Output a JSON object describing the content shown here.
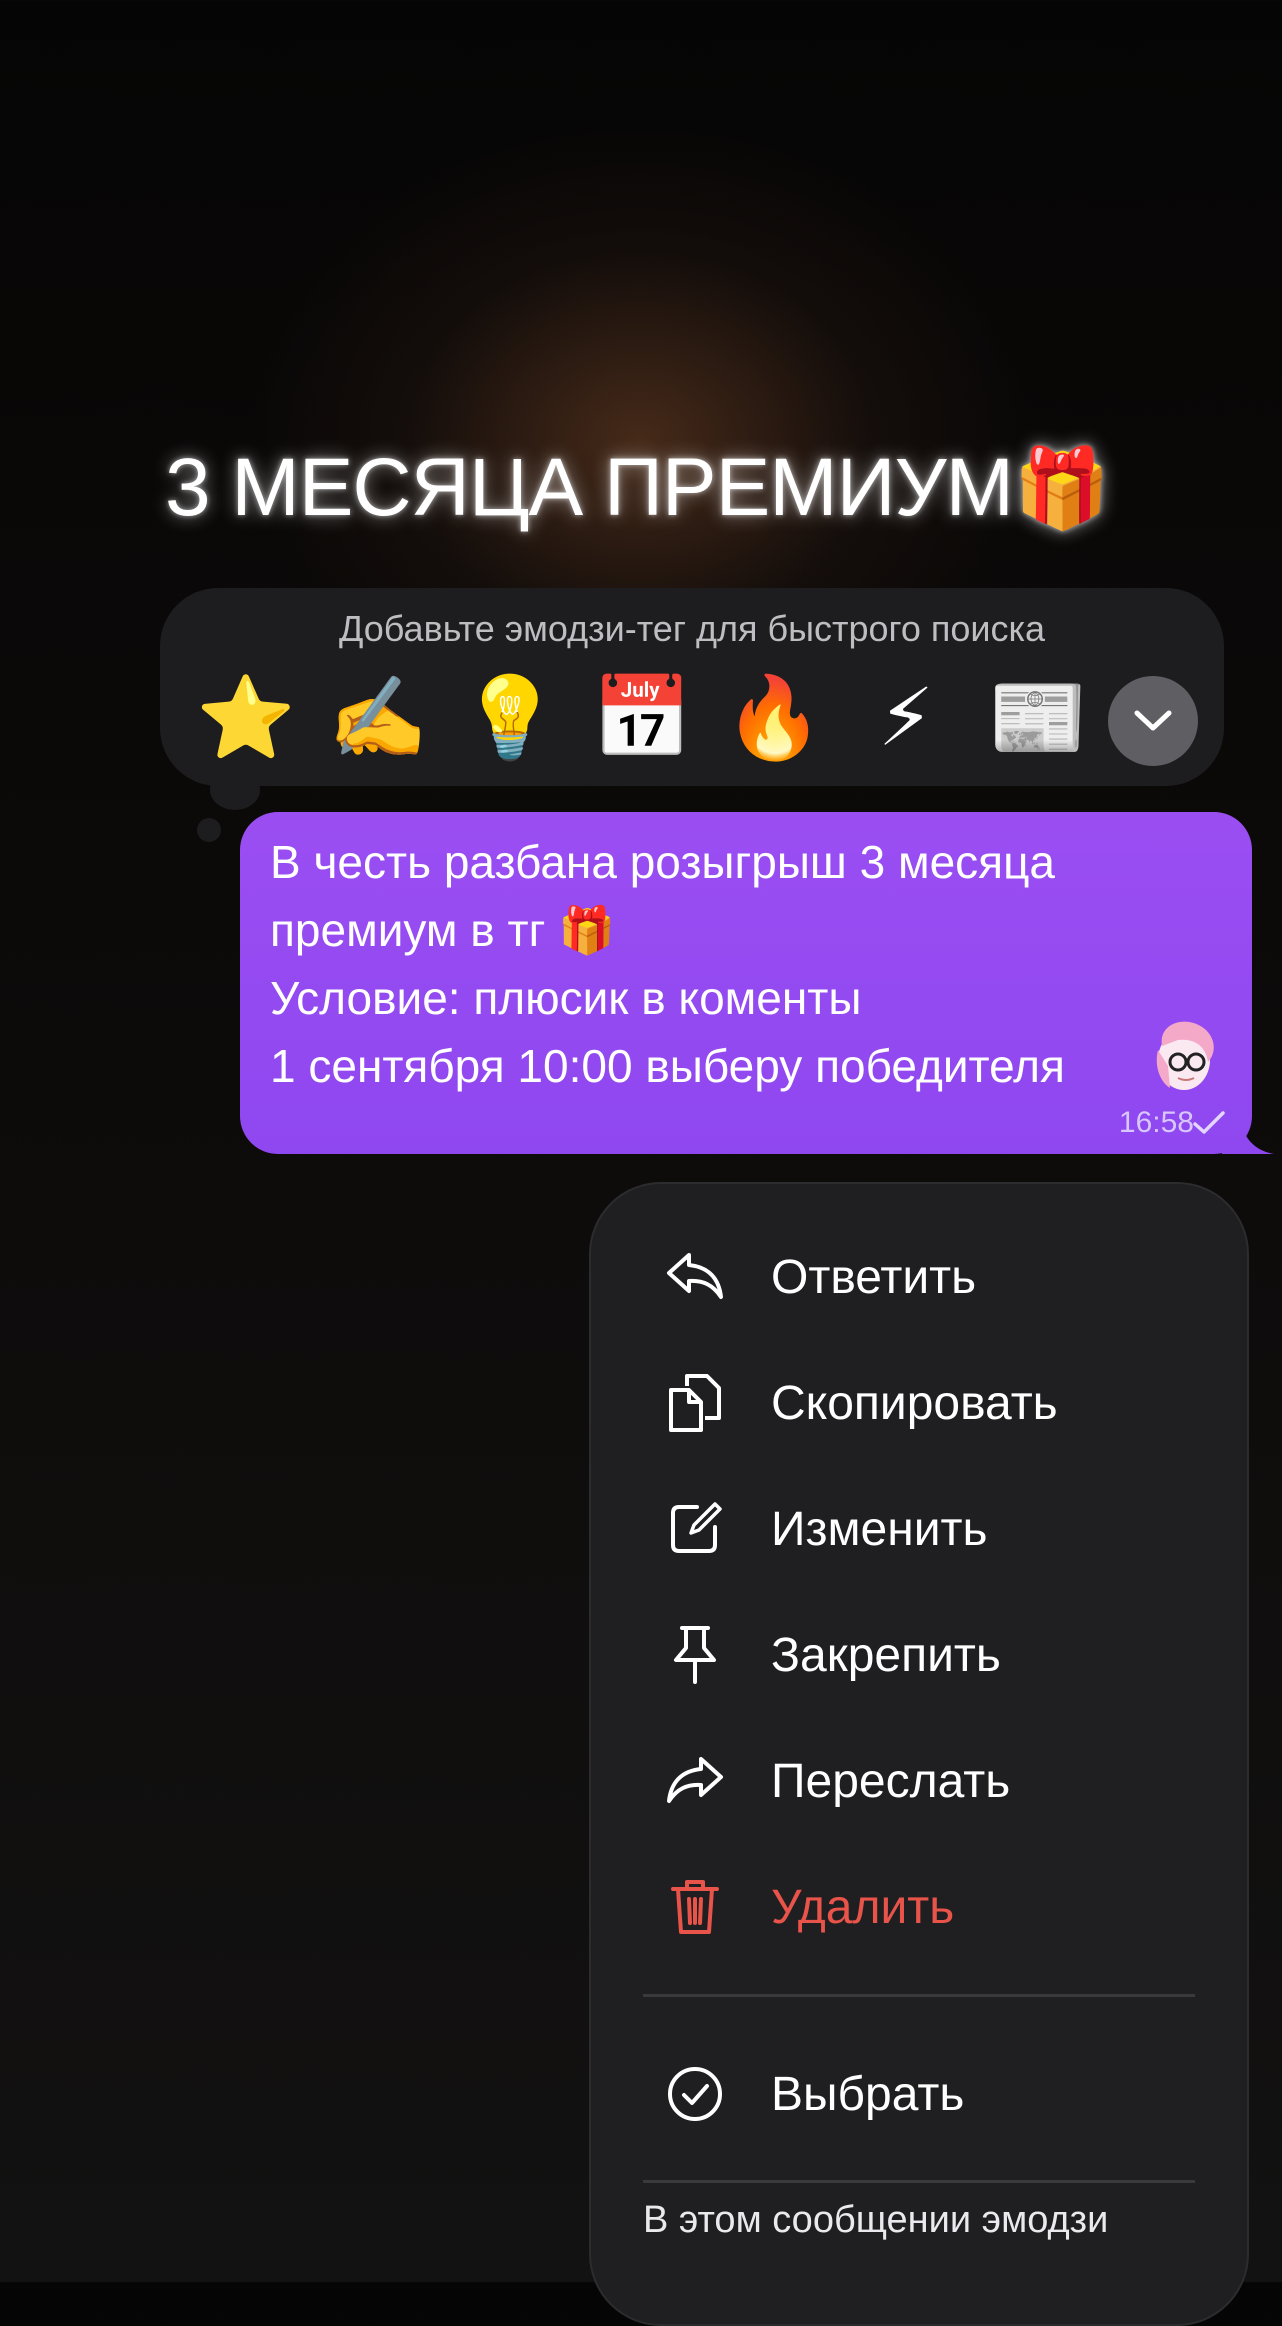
{
  "headline": {
    "text": "3 МЕСЯЦА ПРЕМИУМ",
    "emoji": "🎁"
  },
  "reactions": {
    "hint": "Добавьте эмодзи-тег для быстрого поиска",
    "emojis": [
      "⭐",
      "✍️",
      "💡",
      "📅",
      "🔥",
      "⚡",
      "📰"
    ],
    "expand_icon": "chevron-down-icon"
  },
  "message": {
    "lines": [
      "В честь разбана розыгрыш 3 месяца",
      "премиум в тг 🎁",
      "Условие: плюсик в коменты",
      "1 сентября 10:00 выберу победителя"
    ],
    "time": "16:58",
    "status_icon": "check-icon",
    "bubble_color": "#9a4ef2"
  },
  "menu": {
    "items": [
      {
        "label": "Ответить",
        "icon": "reply-icon"
      },
      {
        "label": "Скопировать",
        "icon": "copy-icon"
      },
      {
        "label": "Изменить",
        "icon": "edit-icon"
      },
      {
        "label": "Закрепить",
        "icon": "pin-icon"
      },
      {
        "label": "Переслать",
        "icon": "forward-icon"
      },
      {
        "label": "Удалить",
        "icon": "trash-icon",
        "danger": true
      }
    ],
    "select": {
      "label": "Выбрать",
      "icon": "check-circle-icon"
    },
    "footnote": "В этом сообщении эмодзи",
    "danger_color": "#e8534a"
  }
}
